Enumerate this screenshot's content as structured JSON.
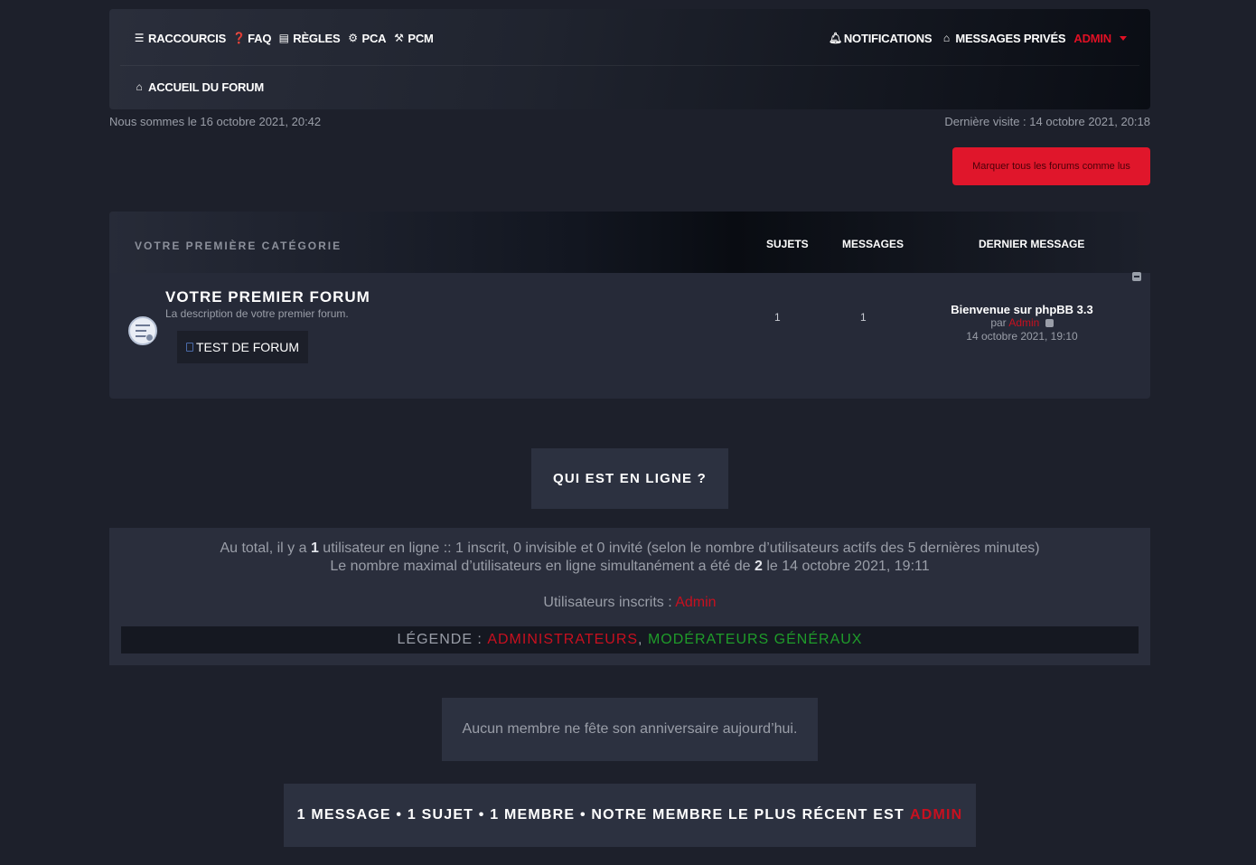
{
  "nav": {
    "left_links": [
      {
        "icon": "bars-icon",
        "label": "RACCOURCIS"
      },
      {
        "icon": "question-icon",
        "label": "FAQ"
      },
      {
        "icon": "book-icon",
        "label": "RÈGLES"
      },
      {
        "icon": "cogs-icon",
        "label": "PCA"
      },
      {
        "icon": "gavel-icon",
        "label": "PCM"
      }
    ],
    "notifications": "NOTIFICATIONS",
    "private_messages": "MESSAGES PRIVÉS",
    "user": "ADMIN",
    "home": "ACCUEIL DU FORUM"
  },
  "date_now": "Nous sommes le 16 octobre 2021, 20:42",
  "last_visit": "Dernière visite : 14 octobre 2021, 20:18",
  "mark_read_button": "Marquer tous les forums comme lus",
  "category": {
    "title": "VOTRE PREMIÈRE CATÉGORIE",
    "col_topics": "SUJETS",
    "col_posts": "MESSAGES",
    "col_last": "DERNIER MESSAGE",
    "forum": {
      "title": "VOTRE PREMIER FORUM",
      "description": "La description de votre premier forum.",
      "subforum": "TEST DE FORUM",
      "topics": "1",
      "posts": "1",
      "last_post_title": "Bienvenue sur phpBB 3.3",
      "last_post_by_label": "par",
      "last_post_author": "Admin",
      "last_post_date": "14 octobre 2021, 19:10"
    }
  },
  "online": {
    "title": "QUI EST EN LIGNE ?",
    "line1_pre": "Au total, il y a",
    "line1_count": "1",
    "line1_post": "utilisateur en ligne :: 1 inscrit, 0 invisible et 0 invité (selon le nombre d’utilisateurs actifs des 5 dernières minutes)",
    "line2_pre": "Le nombre maximal d’utilisateurs en ligne simultanément a été de",
    "line2_count": "2",
    "line2_post": "le 14 octobre 2021, 19:11",
    "registered_label": "Utilisateurs inscrits :",
    "registered_user": "Admin",
    "legend_label": "LÉGENDE :",
    "legend_admins": "ADMINISTRATEURS",
    "legend_sep": ",",
    "legend_mods": "MODÉRATEURS GÉNÉRAUX"
  },
  "birthday": "Aucun membre ne fête son anniversaire aujourd’hui.",
  "stats": {
    "text": "1 MESSAGE • 1 SUJET • 1 MEMBRE • NOTRE MEMBRE LE PLUS RÉCENT EST",
    "newest": "ADMIN"
  },
  "colors": {
    "background": "#1d202b",
    "accent_red": "#e0162b",
    "moderator_green": "#1f9c2a"
  }
}
